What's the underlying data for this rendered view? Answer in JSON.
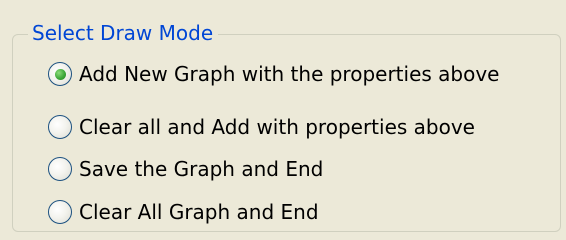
{
  "draw_mode_group": {
    "title": "Select Draw Mode",
    "selected_index": 0,
    "options": [
      {
        "label": "Add New Graph with the properties above",
        "checked": true
      },
      {
        "label": "Clear all and Add with properties above",
        "checked": false
      },
      {
        "label": "Save the Graph and End",
        "checked": false
      },
      {
        "label": "Clear All Graph and End",
        "checked": false
      }
    ]
  },
  "colors": {
    "window_background": "#ece9d8",
    "group_title": "#0046d5",
    "group_border": "#d0d0bf",
    "radio_border": "#1c5180",
    "radio_selected_dot": "#3fa83b"
  }
}
